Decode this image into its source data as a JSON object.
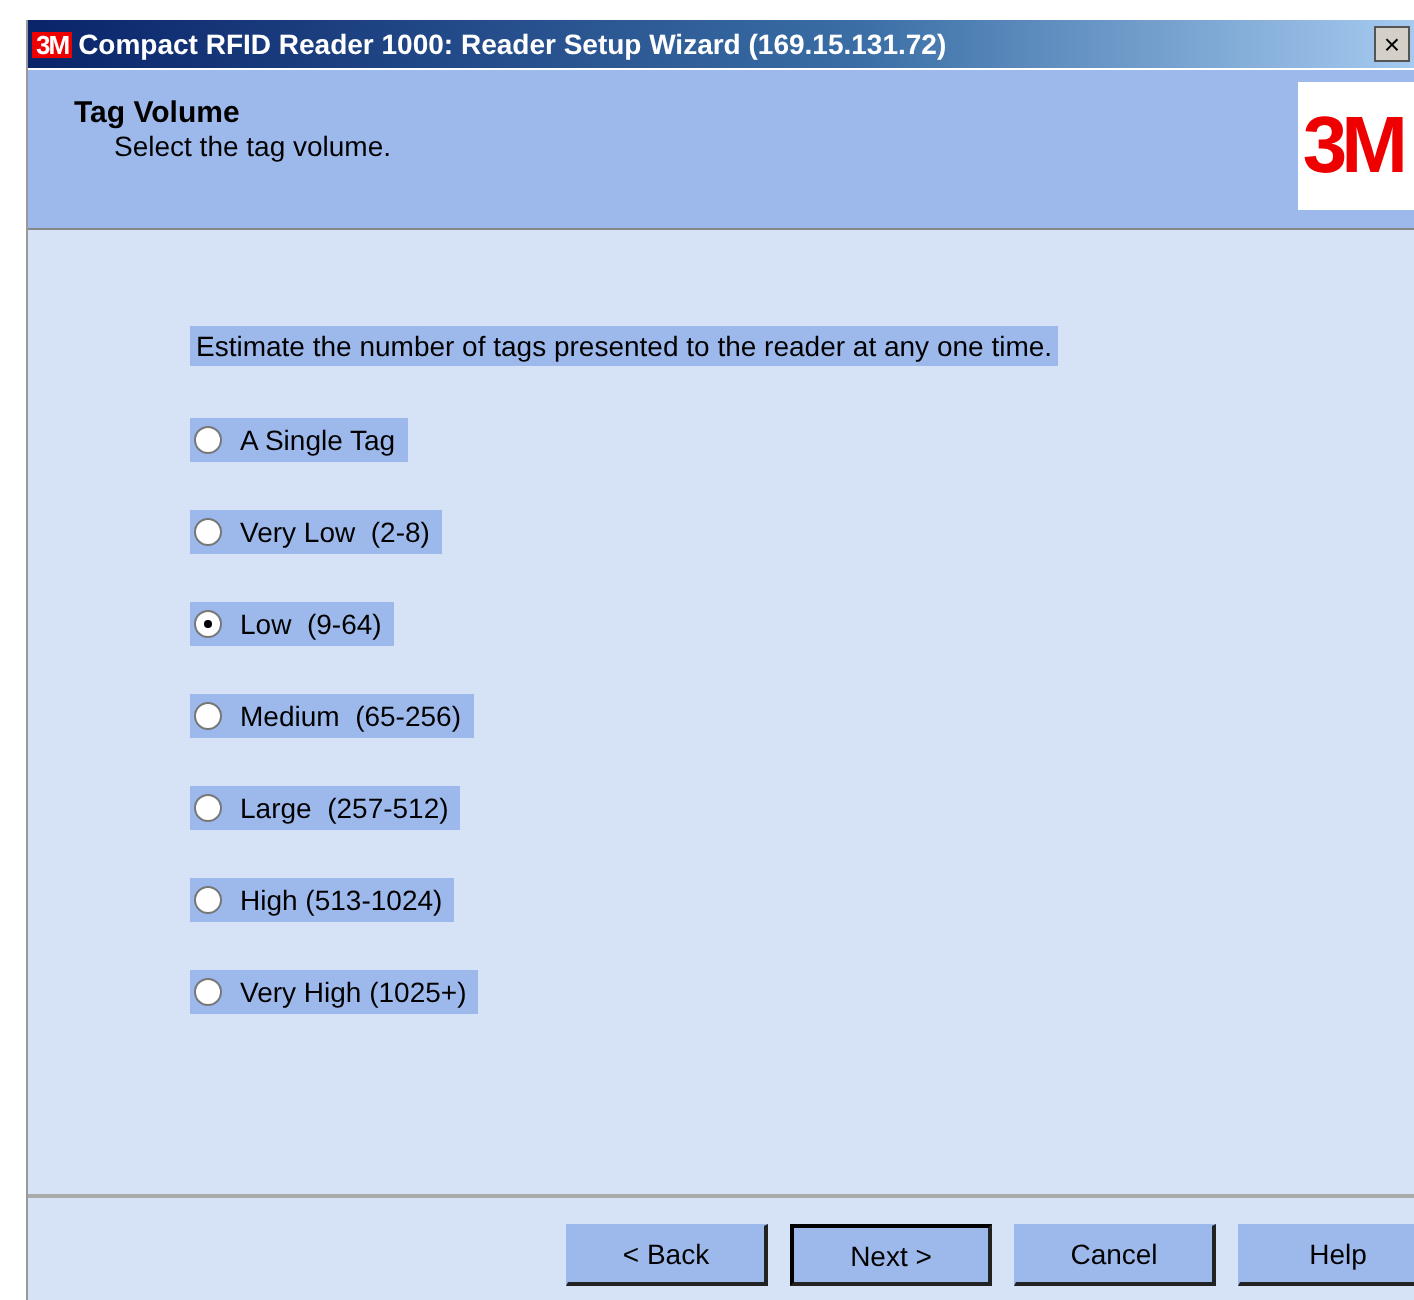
{
  "window": {
    "icon_text": "3M",
    "title": "Compact RFID Reader 1000: Reader Setup Wizard (169.15.131.72)",
    "close": "×"
  },
  "header": {
    "title": "Tag Volume",
    "subtitle": "Select the tag volume.",
    "logo_text": "3M"
  },
  "prompt": "Estimate the number of tags presented to the reader at any one time.",
  "options": [
    {
      "label": "A Single Tag",
      "selected": false
    },
    {
      "label": "Very Low  (2-8)",
      "selected": false
    },
    {
      "label": "Low  (9-64)",
      "selected": true
    },
    {
      "label": "Medium  (65-256)",
      "selected": false
    },
    {
      "label": "Large  (257-512)",
      "selected": false
    },
    {
      "label": "High (513-1024)",
      "selected": false
    },
    {
      "label": "Very High (1025+)",
      "selected": false
    }
  ],
  "buttons": [
    {
      "label": "< Back",
      "default": false
    },
    {
      "label": "Next >",
      "default": true
    },
    {
      "label": "Cancel",
      "default": false
    },
    {
      "label": "Help",
      "default": false
    }
  ]
}
